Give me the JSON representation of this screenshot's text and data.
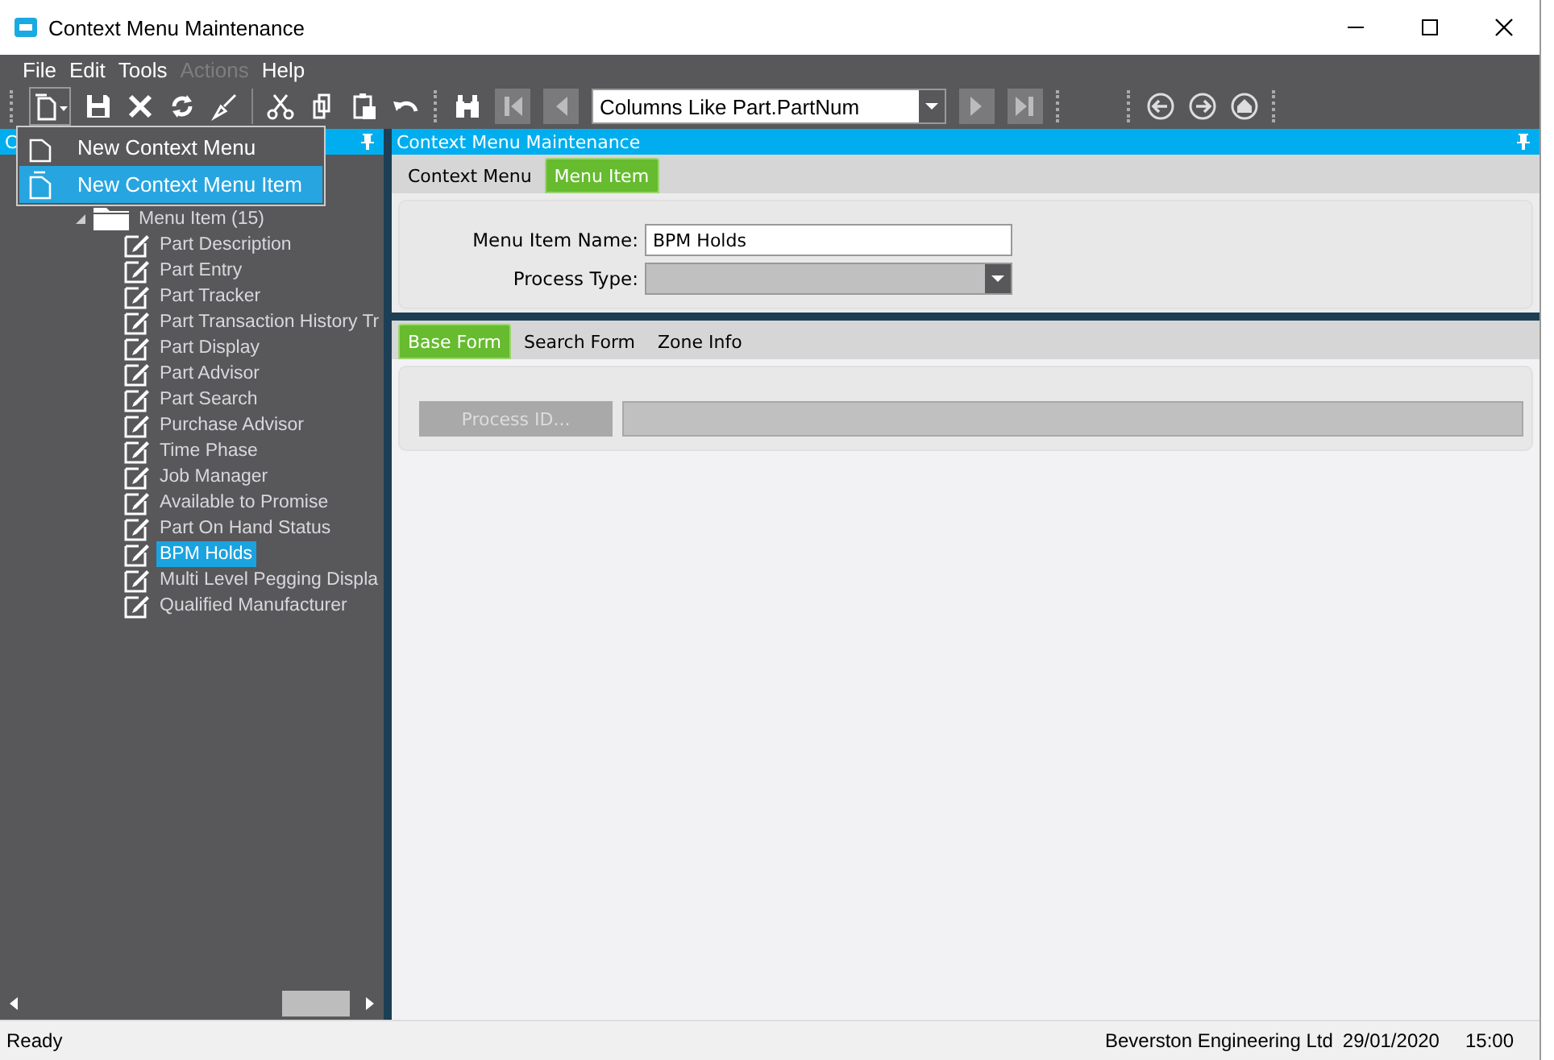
{
  "window": {
    "title": "Context Menu Maintenance"
  },
  "menu_bar": [
    {
      "label": "File",
      "disabled": false
    },
    {
      "label": "Edit",
      "disabled": false
    },
    {
      "label": "Tools",
      "disabled": false
    },
    {
      "label": "Actions",
      "disabled": true
    },
    {
      "label": "Help",
      "disabled": false
    }
  ],
  "toolbar": {
    "search_combo": {
      "value": "Columns Like Part.PartNum"
    }
  },
  "dropdown_menu": [
    {
      "label": "New Context Menu",
      "selected": false
    },
    {
      "label": "New Context Menu Item",
      "selected": true
    }
  ],
  "tree_panel": {
    "title": "C",
    "tree": {
      "label": "Menu Item (15)",
      "expanded": true,
      "children": [
        {
          "label": "Part Description",
          "selected": false
        },
        {
          "label": "Part Entry",
          "selected": false
        },
        {
          "label": "Part Tracker",
          "selected": false
        },
        {
          "label": "Part Transaction History Tr",
          "selected": false
        },
        {
          "label": "Part Display",
          "selected": false
        },
        {
          "label": "Part Advisor",
          "selected": false
        },
        {
          "label": "Part Search",
          "selected": false
        },
        {
          "label": "Purchase Advisor",
          "selected": false
        },
        {
          "label": "Time Phase",
          "selected": false
        },
        {
          "label": "Job Manager",
          "selected": false
        },
        {
          "label": "Available to Promise",
          "selected": false
        },
        {
          "label": "Part On Hand Status",
          "selected": false
        },
        {
          "label": "BPM Holds",
          "selected": true
        },
        {
          "label": "Multi Level Pegging Displa",
          "selected": false
        },
        {
          "label": "Qualified Manufacturer",
          "selected": false
        }
      ]
    }
  },
  "detail_panel": {
    "title": "Context Menu Maintenance",
    "tabs": [
      {
        "label": "Context Menu",
        "selected": false
      },
      {
        "label": "Menu Item",
        "selected": true
      }
    ],
    "menu_item_name": {
      "label": "Menu Item Name:",
      "value": "BPM Holds"
    },
    "process_type": {
      "label": "Process Type:"
    },
    "sub_tabs": [
      {
        "label": "Base Form",
        "selected": true
      },
      {
        "label": "Search Form",
        "selected": false
      },
      {
        "label": "Zone Info",
        "selected": false
      }
    ],
    "process_id_button": {
      "label": "Process ID...",
      "disabled": true
    }
  },
  "status_bar": {
    "status": "Ready",
    "company": "Beverston Engineering Ltd",
    "date": "29/01/2020",
    "time": "15:00"
  }
}
